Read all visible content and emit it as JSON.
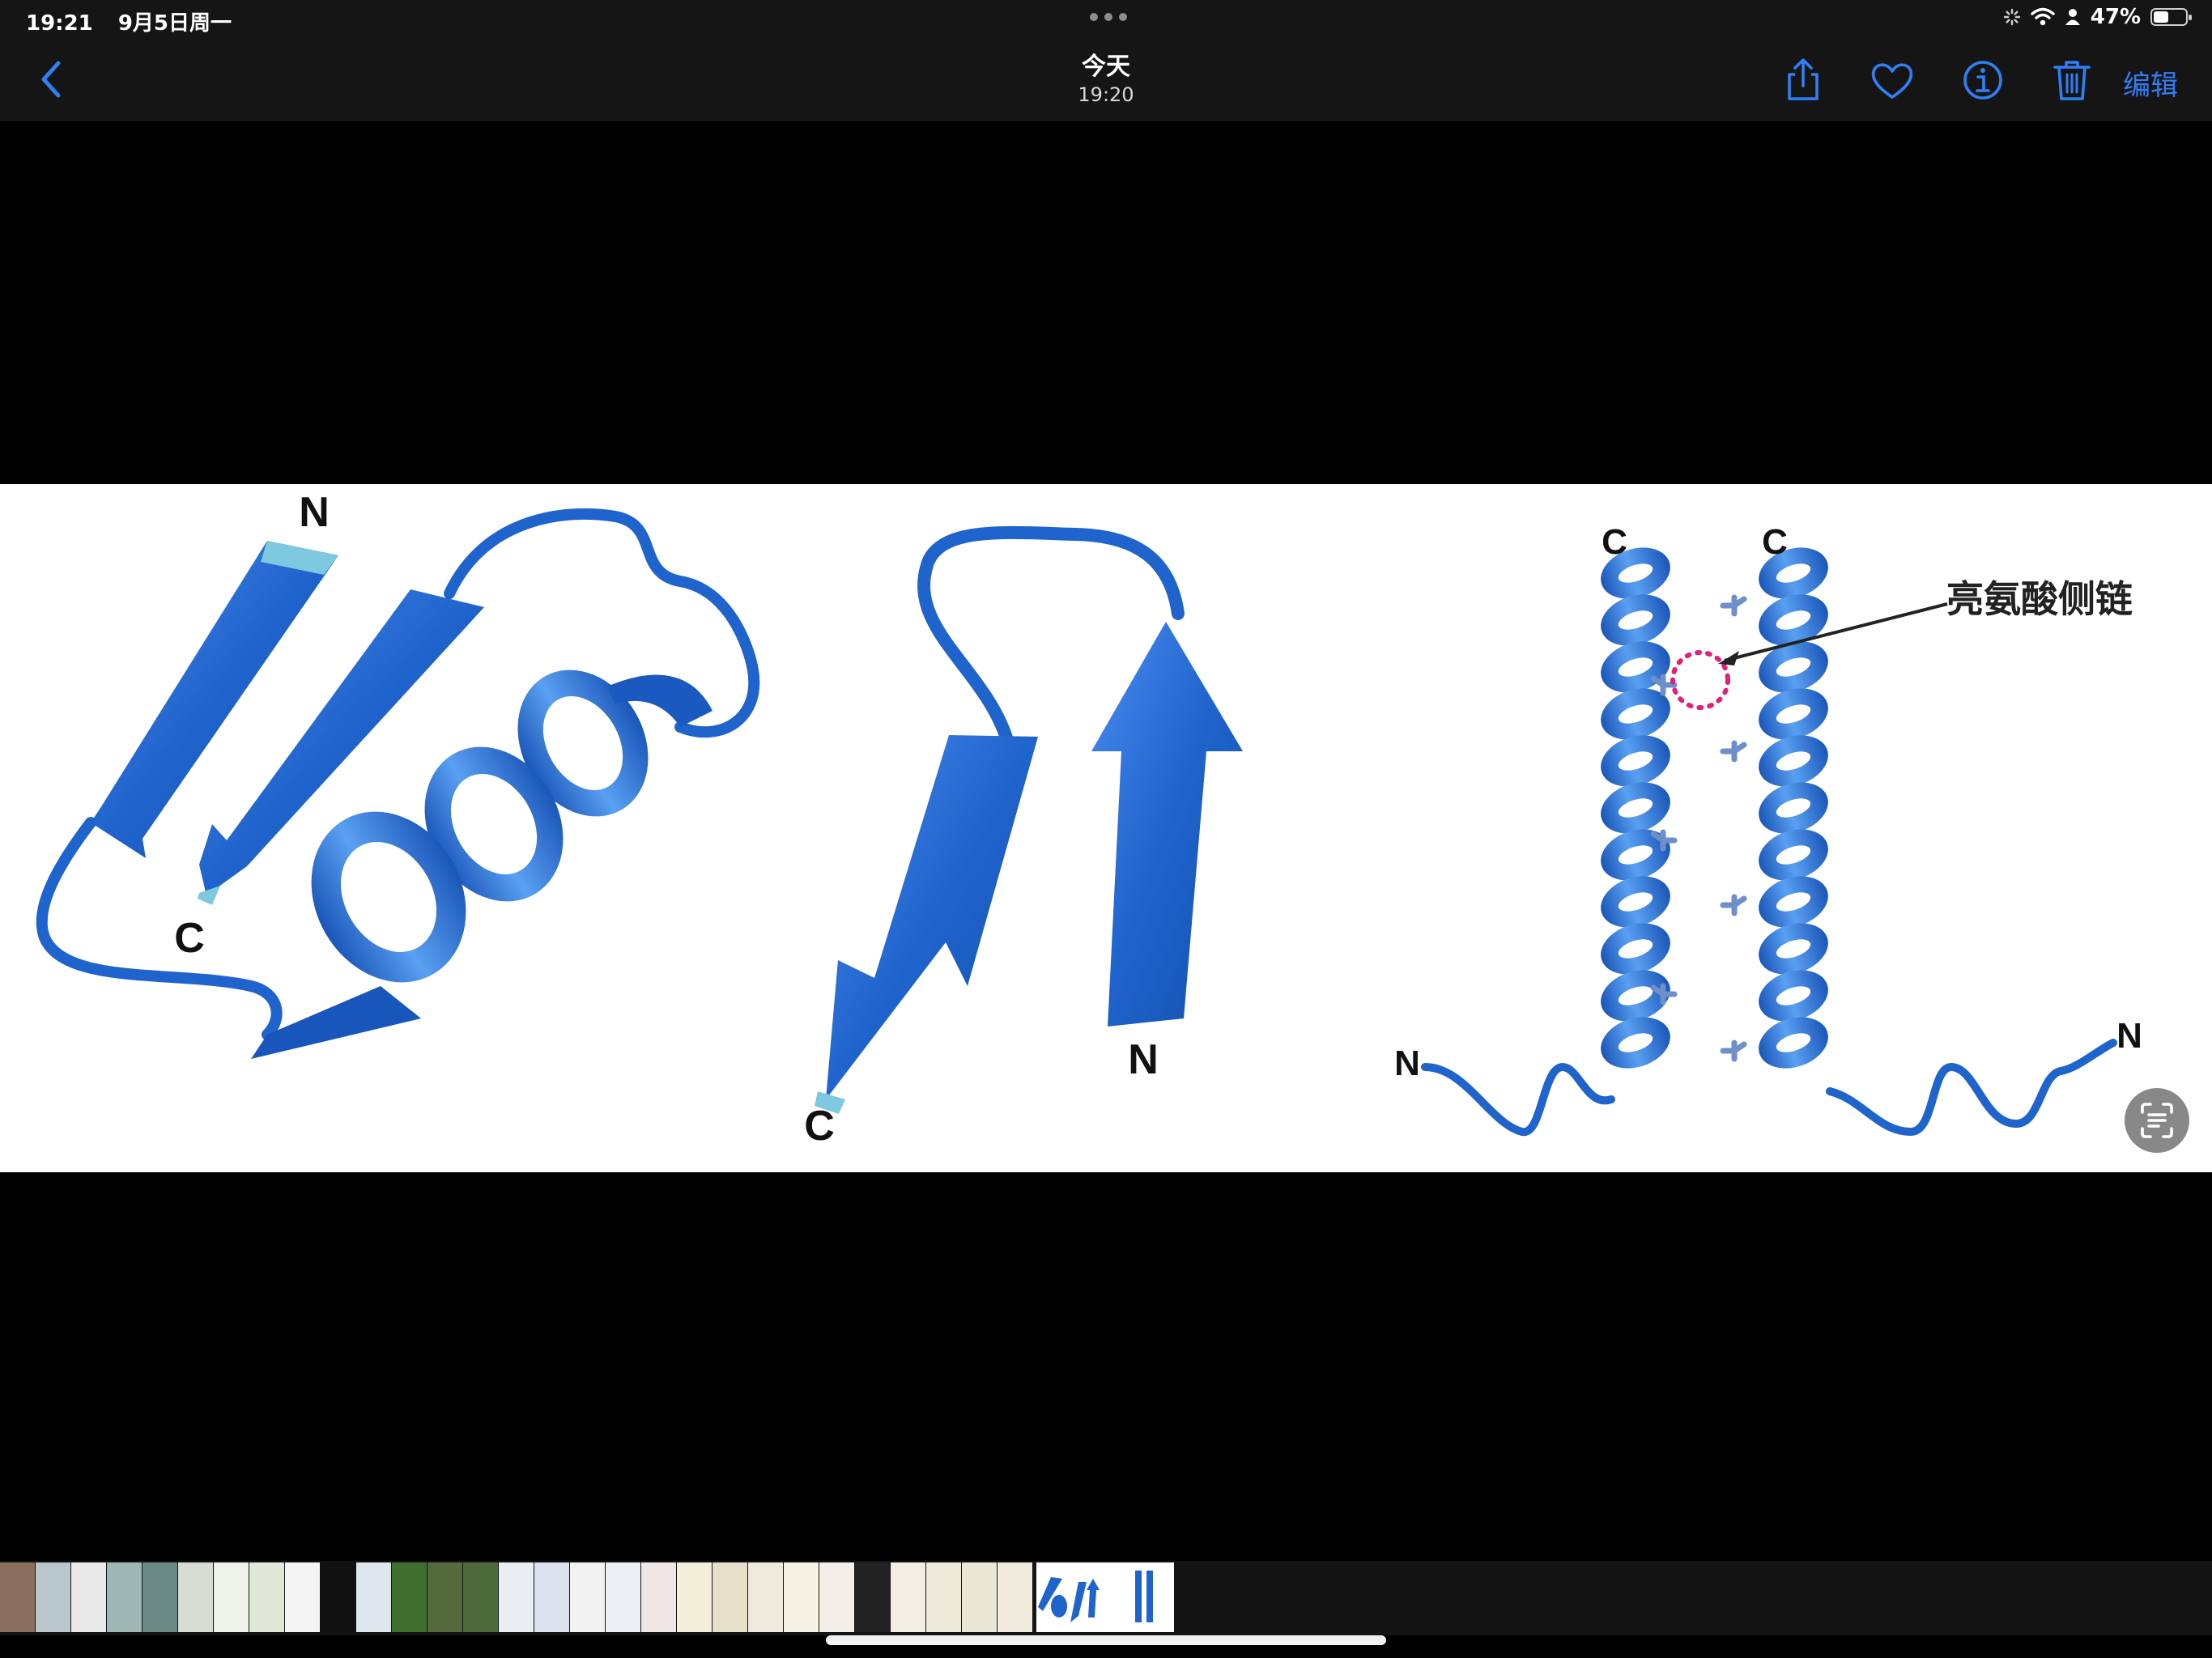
{
  "status_bar": {
    "time": "19:21",
    "date": "9月5日周一",
    "battery_text": "47%",
    "battery_level": 0.47,
    "icons": [
      "activity-spinner-icon",
      "wifi-icon",
      "person-icon",
      "battery-icon"
    ]
  },
  "nav_bar": {
    "title": "今天",
    "subtitle": "19:20",
    "edit_label": "编辑",
    "accent_color": "#2f7ff5",
    "icons": [
      "chevron-left-icon",
      "share-icon",
      "heart-icon",
      "info-icon",
      "trash-icon"
    ]
  },
  "photo": {
    "labels": {
      "left_n": "N",
      "left_c": "C",
      "middle_n": "N",
      "middle_c": "C",
      "right_c1": "C",
      "right_c2": "C",
      "right_n1": "N",
      "right_n2": "N",
      "annotation": "亮氨酸侧链"
    },
    "ribbon_color": "#1f63cc"
  },
  "live_text_button": {
    "icon": "live-text-icon"
  },
  "filmstrip": {
    "thumbnail_colors": [
      "#8a6e5e",
      "#b9c6cc",
      "#e9e9e9",
      "#9fb7b4",
      "#6b8a86",
      "#d7ddd2",
      "#eef2e8",
      "#dfe8d9",
      "#f4f4f4",
      "#111111",
      "#dfe7ee",
      "#3f6f2e",
      "#556b3d",
      "#4d6a3a",
      "#e9eef2",
      "#dbe2ee",
      "#f2f2f2",
      "#eceff6",
      "#f0e6e6",
      "#f3eeda",
      "#e7e1cc",
      "#efeadb",
      "#f5f2e4",
      "#f1efe7",
      "#222222",
      "#f1eee4",
      "#eeeada",
      "#ebe7d6",
      "#f0ebdc"
    ]
  }
}
